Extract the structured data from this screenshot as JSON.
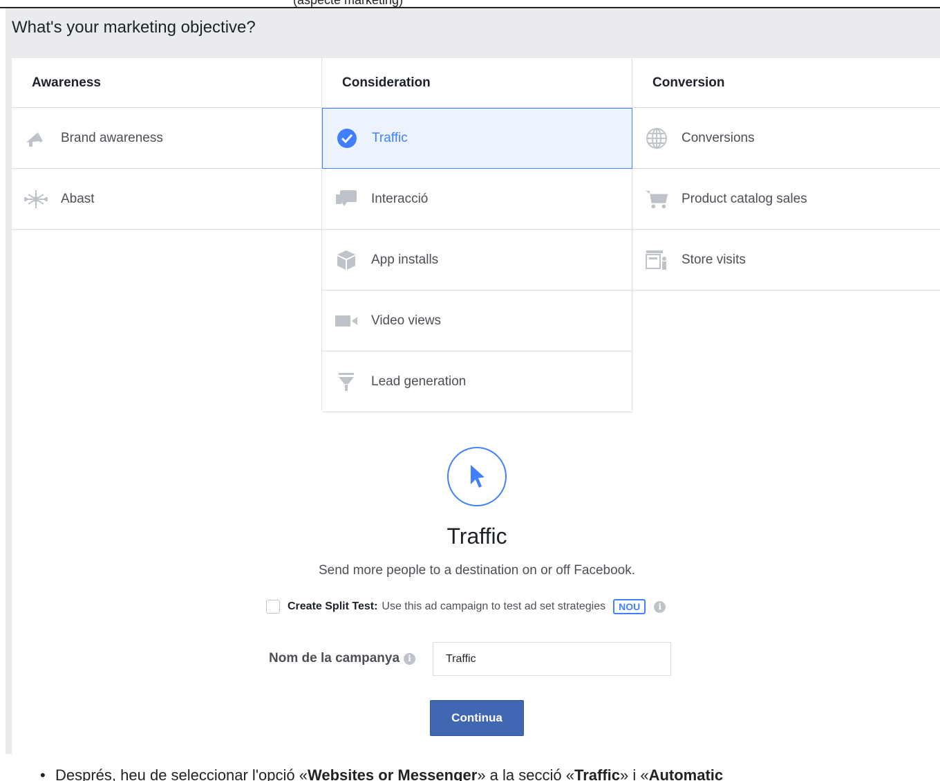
{
  "header": {
    "top_fragment": "(aspecte marketing)",
    "title": "What's your marketing objective?"
  },
  "columns": [
    {
      "title": "Awareness",
      "options": [
        {
          "label": "Brand awareness",
          "icon": "megaphone-icon"
        },
        {
          "label": "Abast",
          "icon": "reach-icon"
        }
      ]
    },
    {
      "title": "Consideration",
      "options": [
        {
          "label": "Traffic",
          "icon": "check-circle-icon",
          "selected": true
        },
        {
          "label": "Interacció",
          "icon": "chat-bubbles-icon"
        },
        {
          "label": "App installs",
          "icon": "box-icon"
        },
        {
          "label": "Video views",
          "icon": "video-camera-icon"
        },
        {
          "label": "Lead generation",
          "icon": "funnel-icon"
        }
      ]
    },
    {
      "title": "Conversion",
      "options": [
        {
          "label": "Conversions",
          "icon": "globe-icon"
        },
        {
          "label": "Product catalog sales",
          "icon": "cart-icon"
        },
        {
          "label": "Store visits",
          "icon": "store-icon"
        }
      ]
    }
  ],
  "detail": {
    "icon": "cursor-icon",
    "title": "Traffic",
    "description": "Send more people to a destination on or off Facebook."
  },
  "split_test": {
    "checked": false,
    "label": "Create Split Test:",
    "text": "Use this ad campaign to test ad set strategies",
    "badge": "NOU"
  },
  "campaign_name": {
    "label": "Nom de la campanya",
    "value": "Traffic"
  },
  "continue_button": "Continua",
  "footer_text": {
    "prefix": "Després, heu de seleccionar l'opció «",
    "bold1": "Websites or Messenger",
    "mid": "» a la secció «",
    "bold2": "Traffic",
    "mid2": "» i «",
    "bold3": "Automatic"
  },
  "colors": {
    "accent": "#4080ff",
    "button": "#4267b2",
    "border": "#dddfe2",
    "panel_bg": "#e9ebee",
    "icon_gray": "#bec2c9"
  }
}
